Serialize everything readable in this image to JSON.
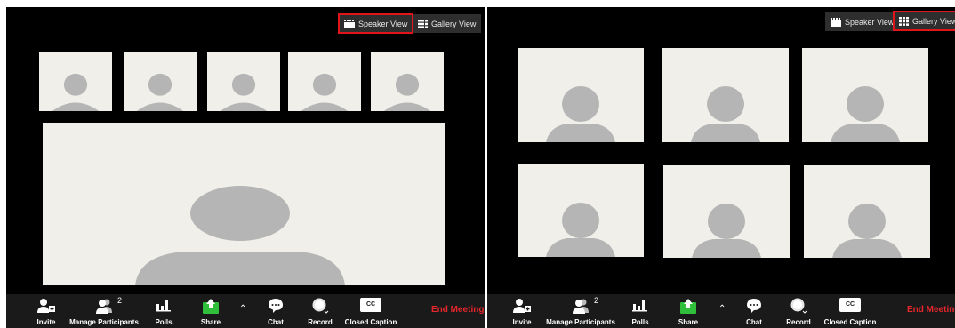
{
  "speaker_screen": {
    "speaker_view_label": "Speaker View",
    "gallery_view_label": "Gallery View",
    "active_view": "speaker"
  },
  "gallery_screen": {
    "speaker_view_label": "Speaker View",
    "gallery_view_label": "Gallery View",
    "active_view": "gallery"
  },
  "toolbar": {
    "invite": "Invite",
    "manage_participants": "Manage Participants",
    "participant_count": "2",
    "polls": "Polls",
    "share": "Share",
    "chat": "Chat",
    "record": "Record",
    "closed_caption": "Closed Caption",
    "cc_badge": "CC",
    "end_meeting": "End Meeting"
  },
  "colors": {
    "background": "#000000",
    "toolbar": "#1a1a1a",
    "tile": "#f0efe9",
    "avatar": "#b5b5b5",
    "highlight": "#e0141b",
    "share_green": "#2fbf3a",
    "end_meeting_red": "#e8262b"
  }
}
